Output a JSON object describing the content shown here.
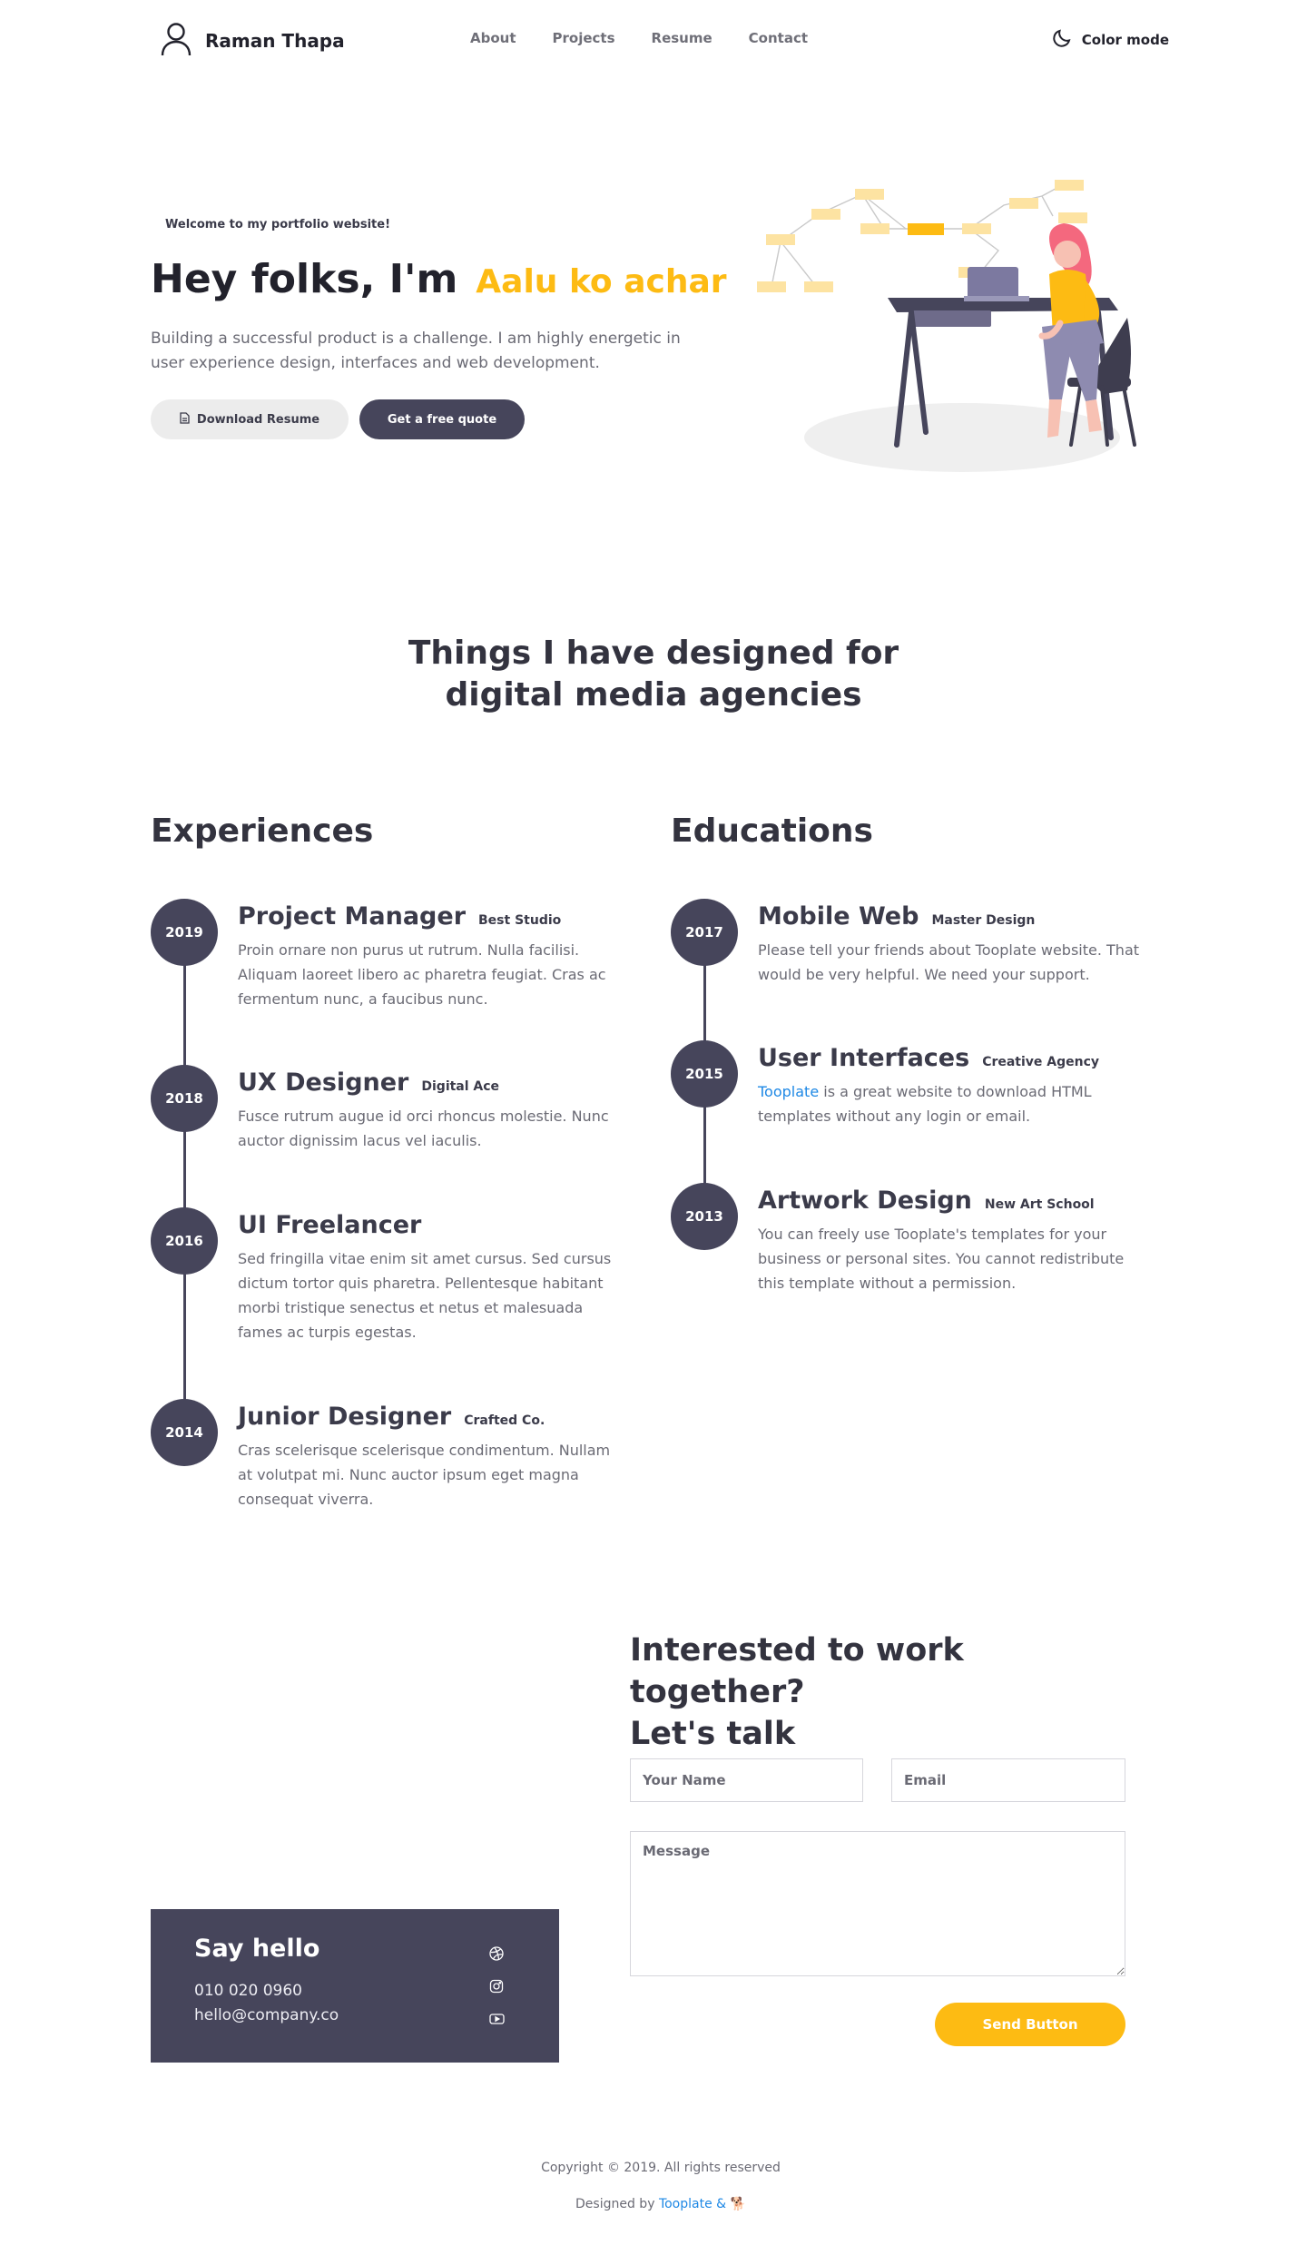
{
  "nav": {
    "brand": "Raman Thapa",
    "links": [
      "About",
      "Projects",
      "Resume",
      "Contact"
    ],
    "color_mode": "Color mode"
  },
  "hero": {
    "welcome": "Welcome to my portfolio website!",
    "title_main": "Hey folks, I'm",
    "title_highlight": "Aalu ko achar",
    "description": "Building a successful product is a challenge. I am highly energetic in user experience design, interfaces and web development.",
    "download_button": "Download Resume",
    "quote_button": "Get a free quote"
  },
  "section": {
    "title": "Things I have designed for digital media agencies"
  },
  "experiences": {
    "title": "Experiences",
    "items": [
      {
        "year": "2019",
        "role": "Project Manager",
        "org": "Best Studio",
        "text": "Proin ornare non purus ut rutrum. Nulla facilisi. Aliquam laoreet libero ac pharetra feugiat. Cras ac fermentum nunc, a faucibus nunc."
      },
      {
        "year": "2018",
        "role": "UX Designer",
        "org": "Digital Ace",
        "text": "Fusce rutrum augue id orci rhoncus molestie. Nunc auctor dignissim lacus vel iaculis."
      },
      {
        "year": "2016",
        "role": "UI Freelancer",
        "org": "",
        "text": "Sed fringilla vitae enim sit amet cursus. Sed cursus dictum tortor quis pharetra. Pellentesque habitant morbi tristique senectus et netus et malesuada fames ac turpis egestas."
      },
      {
        "year": "2014",
        "role": "Junior Designer",
        "org": "Crafted Co.",
        "text": "Cras scelerisque scelerisque condimentum. Nullam at volutpat mi. Nunc auctor ipsum eget magna consequat viverra."
      }
    ]
  },
  "educations": {
    "title": "Educations",
    "items": [
      {
        "year": "2017",
        "role": "Mobile Web",
        "org": "Master Design",
        "text": "Please tell your friends about Tooplate website. That would be very helpful. We need your support."
      },
      {
        "year": "2015",
        "role": "User Interfaces",
        "org": "Creative Agency",
        "link": "Tooplate",
        "text": " is a great website to download HTML templates without any login or email."
      },
      {
        "year": "2013",
        "role": "Artwork Design",
        "org": "New Art School",
        "text": "You can freely use Tooplate's templates for your business or personal sites. You cannot redistribute this template without a permission."
      }
    ]
  },
  "contact": {
    "title_line1": "Interested to work together?",
    "title_line2": "Let's talk",
    "name_placeholder": "Your Name",
    "email_placeholder": "Email",
    "message_placeholder": "Message",
    "send_button": "Send Button"
  },
  "say_hello": {
    "title": "Say hello",
    "phone": "010 020 0960",
    "email": "hello@company.co",
    "social_icons": [
      "dribbble-icon",
      "instagram-icon",
      "youtube-icon"
    ]
  },
  "footer": {
    "copyright": "Copyright © 2019. All rights reserved",
    "designed_by": "Designed by",
    "designed_link": "Tooplate &",
    "emoji": "🐕"
  },
  "colors": {
    "accent": "#fdbb13",
    "dark": "#46455b",
    "link": "#1e88e5"
  }
}
